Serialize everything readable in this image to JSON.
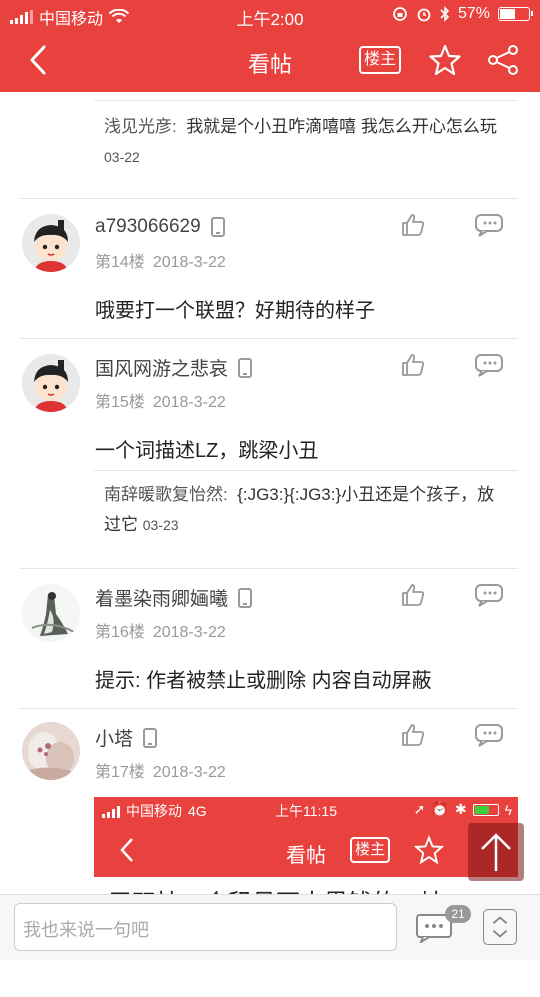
{
  "status_bar": {
    "carrier": "中国移动",
    "time": "上午2:00",
    "battery_percent": "57%",
    "battery_level": 0.57
  },
  "nav": {
    "title": "看帖",
    "louzhu": "楼主"
  },
  "top_reply": {
    "name": "浅见光彦:",
    "text": "我就是个小丑咋滴嘻嘻 我怎么开心怎么玩",
    "date": "03-22"
  },
  "posts": [
    {
      "username": "a793066629",
      "floor": "第14楼",
      "date": "2018-3-22",
      "body": "哦要打一个联盟？好期待的样子"
    },
    {
      "username": "国风网游之悲哀",
      "floor": "第15楼",
      "date": "2018-3-22",
      "body": "一个词描述LZ，跳梁小丑",
      "reply": {
        "name": "南辞暖歌复怡然:",
        "text": "{:JG3:}{:JG3:}小丑还是个孩子，放过它",
        "date": "03-23"
      }
    },
    {
      "username": "着墨染雨卿婳曦",
      "floor": "第16楼",
      "date": "2018-3-22",
      "body": "提示: 作者被禁止或删除 内容自动屏蔽"
    },
    {
      "username": "小塔",
      "floor": "第17楼",
      "date": "2018-3-22"
    }
  ],
  "embedded_screenshot": {
    "carrier": "中国移动",
    "network": "4G",
    "time": "上午11:15",
    "title": "看帖",
    "louzhu": "楼主",
    "cut_text": "于双挂一个租号下木黑钱的，妹"
  },
  "bottom_bar": {
    "input_placeholder": "我也来说一句吧",
    "comment_count": "21"
  },
  "colors": {
    "brand_red": "#e8413e"
  }
}
